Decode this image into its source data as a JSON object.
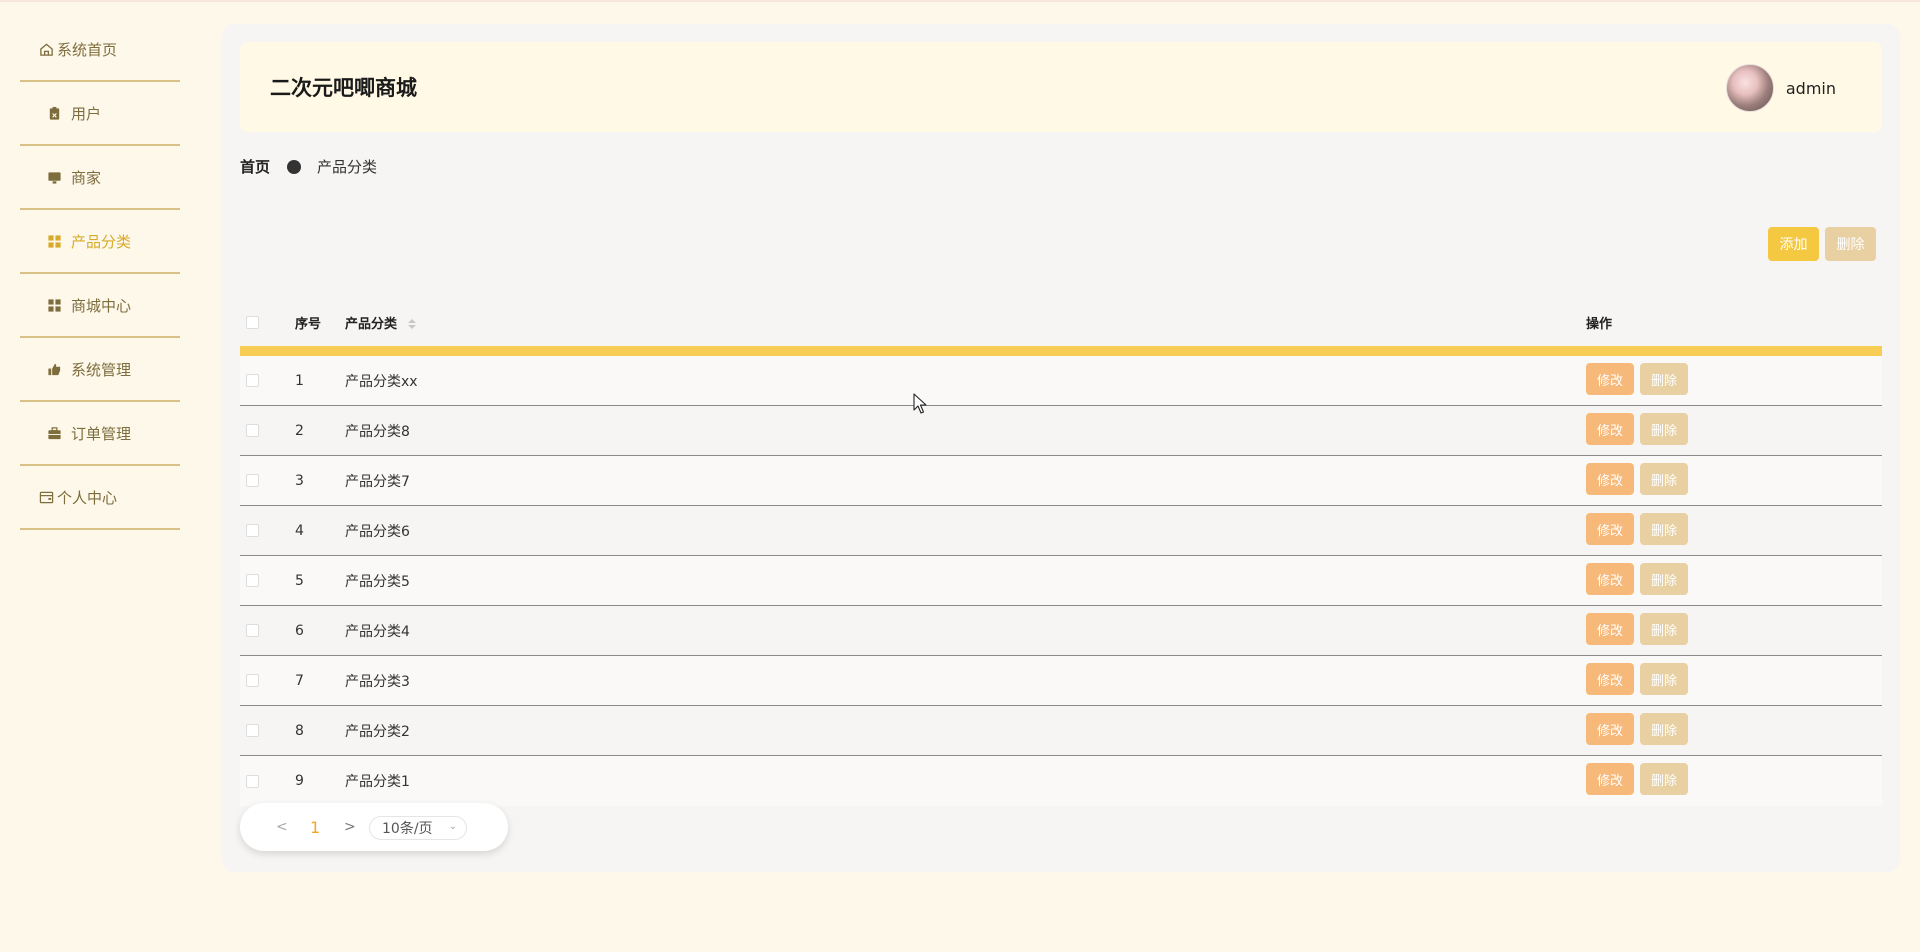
{
  "app": {
    "title": "二次元吧唧商城",
    "username": "admin"
  },
  "sidebar": {
    "items": [
      {
        "label": "系统首页",
        "icon": "home-icon"
      },
      {
        "label": "用户",
        "icon": "clipboard-icon"
      },
      {
        "label": "商家",
        "icon": "monitor-icon"
      },
      {
        "label": "产品分类",
        "icon": "grid-icon",
        "active": true
      },
      {
        "label": "商城中心",
        "icon": "grid-icon"
      },
      {
        "label": "系统管理",
        "icon": "thumb-icon"
      },
      {
        "label": "订单管理",
        "icon": "briefcase-icon"
      },
      {
        "label": "个人中心",
        "icon": "card-icon"
      }
    ]
  },
  "breadcrumb": {
    "home": "首页",
    "current": "产品分类"
  },
  "toolbar": {
    "add_label": "添加",
    "delete_label": "删除"
  },
  "table": {
    "columns": {
      "index": "序号",
      "name": "产品分类",
      "actions": "操作"
    },
    "rows": [
      {
        "index": "1",
        "name": "产品分类xx"
      },
      {
        "index": "2",
        "name": "产品分类8"
      },
      {
        "index": "3",
        "name": "产品分类7"
      },
      {
        "index": "4",
        "name": "产品分类6"
      },
      {
        "index": "5",
        "name": "产品分类5"
      },
      {
        "index": "6",
        "name": "产品分类4"
      },
      {
        "index": "7",
        "name": "产品分类3"
      },
      {
        "index": "8",
        "name": "产品分类2"
      },
      {
        "index": "9",
        "name": "产品分类1"
      }
    ],
    "edit_label": "修改",
    "delete_label": "删除"
  },
  "pagination": {
    "prev": "<",
    "current": "1",
    "next": ">",
    "page_size": "10条/页"
  },
  "colors": {
    "accent": "#f5c842",
    "edit": "#f6b97a",
    "delete": "#e8d0a3",
    "sidebar_active": "#d6ab2b",
    "page_background": "#fef8ea"
  }
}
